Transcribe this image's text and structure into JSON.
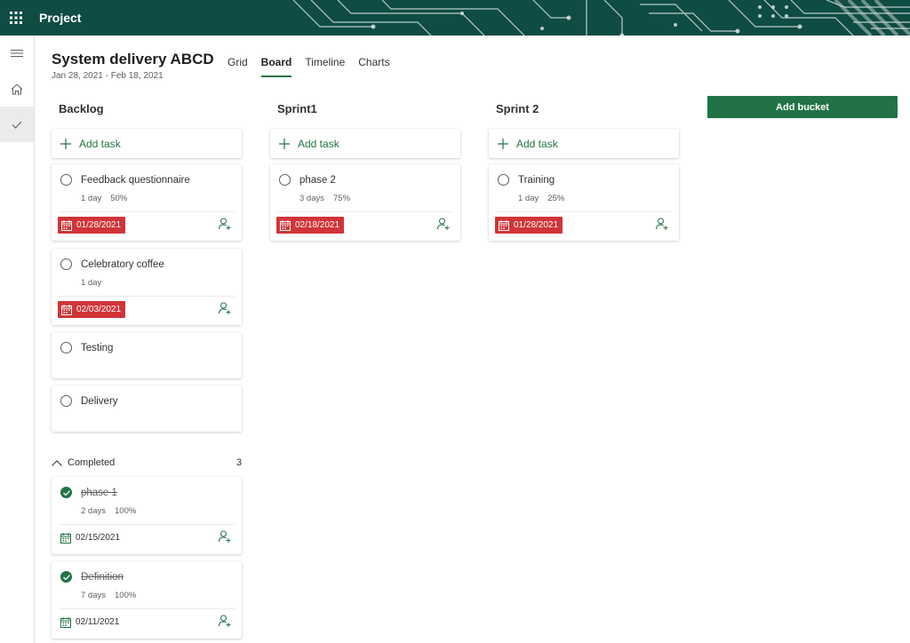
{
  "app": {
    "name": "Project"
  },
  "plan": {
    "title": "System delivery ABCD",
    "dates": "Jan 28, 2021 - Feb 18, 2021"
  },
  "tabs": [
    {
      "label": "Grid",
      "active": false
    },
    {
      "label": "Board",
      "active": true
    },
    {
      "label": "Timeline",
      "active": false
    },
    {
      "label": "Charts",
      "active": false
    }
  ],
  "add_task_label": "Add task",
  "add_bucket_label": "Add bucket",
  "colors": {
    "accent": "#217346",
    "late": "#d13438",
    "topbar": "#0f4c44"
  },
  "buckets": [
    {
      "title": "Backlog",
      "tasks": [
        {
          "name": "Feedback questionnaire",
          "duration": "1 day",
          "progress": "50%",
          "due": "01/28/2021",
          "late": true
        },
        {
          "name": "Celebratory coffee",
          "duration": "1 day",
          "progress": "",
          "due": "02/03/2021",
          "late": true
        },
        {
          "name": "Testing"
        },
        {
          "name": "Delivery"
        }
      ],
      "completed": {
        "label": "Completed",
        "count": "3",
        "tasks": [
          {
            "name": "phase 1",
            "duration": "2 days",
            "progress": "100%",
            "due": "02/15/2021"
          },
          {
            "name": "Definition",
            "duration": "7 days",
            "progress": "100%",
            "due": "02/11/2021"
          }
        ]
      }
    },
    {
      "title": "Sprint1",
      "tasks": [
        {
          "name": "phase 2",
          "duration": "3 days",
          "progress": "75%",
          "due": "02/18/2021",
          "late": true
        }
      ]
    },
    {
      "title": "Sprint 2",
      "tasks": [
        {
          "name": "Training",
          "duration": "1 day",
          "progress": "25%",
          "due": "01/28/2021",
          "late": true
        }
      ]
    }
  ],
  "icons": {
    "waffle": "waffle-icon",
    "menu": "hamburger-icon",
    "home": "home-icon",
    "tasks": "checkmark-icon",
    "add": "plus-icon",
    "calendar": "calendar-icon",
    "assign": "assign-person-icon",
    "collapse": "chevron-up-icon"
  }
}
